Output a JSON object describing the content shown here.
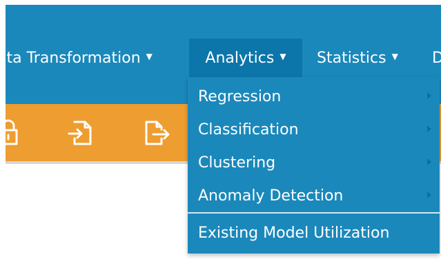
{
  "navbar": {
    "items": [
      {
        "label": "ata Transformation",
        "caret": "▼"
      },
      {
        "label": "Analytics",
        "caret": "▼"
      },
      {
        "label": "Statistics",
        "caret": "▼"
      },
      {
        "label": "D",
        "caret": ""
      }
    ]
  },
  "toolbar": {
    "icons": [
      "lock-icon",
      "file-import-icon",
      "file-export-icon"
    ]
  },
  "analytics_menu": {
    "items": [
      {
        "label": "Regression"
      },
      {
        "label": "Classification"
      },
      {
        "label": "Clustering"
      },
      {
        "label": "Anomaly Detection"
      }
    ],
    "footer_item": {
      "label": "Existing Model Utilization"
    }
  },
  "colors": {
    "navbar": "#1b88bb",
    "navbar_active": "#0c76aa",
    "toolbar": "#ee9d30",
    "submenu_arrow": "#0d6f9f"
  }
}
